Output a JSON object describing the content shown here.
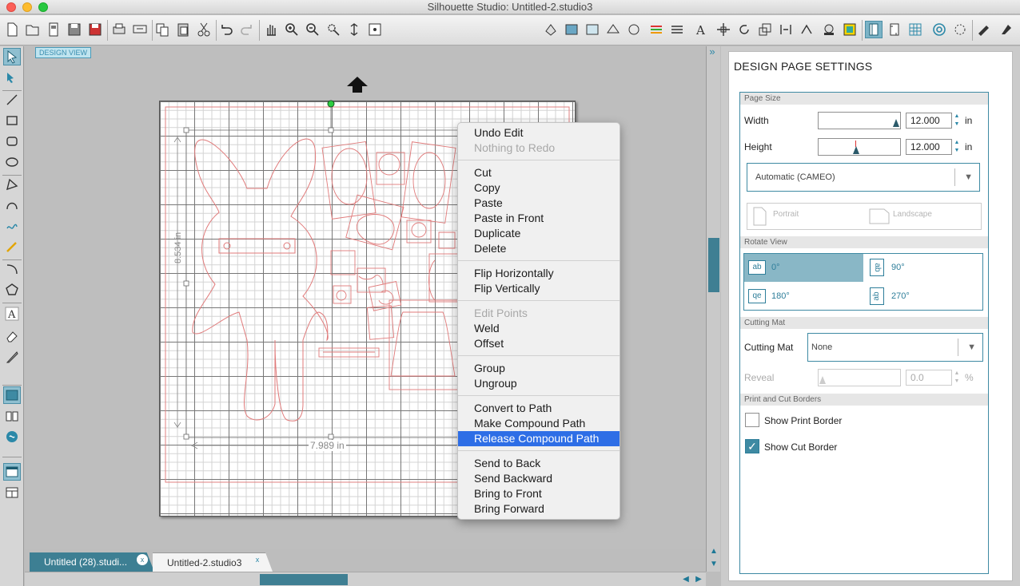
{
  "window": {
    "title": "Silhouette Studio: Untitled-2.studio3"
  },
  "canvas": {
    "design_view_label": "DESIGN VIEW",
    "height_dimension": "8.534 in",
    "width_dimension": "7.989 in"
  },
  "context_menu": {
    "groups": [
      [
        {
          "label": "Undo Edit",
          "enabled": true
        },
        {
          "label": "Nothing to Redo",
          "enabled": false
        }
      ],
      [
        {
          "label": "Cut",
          "enabled": true
        },
        {
          "label": "Copy",
          "enabled": true
        },
        {
          "label": "Paste",
          "enabled": true
        },
        {
          "label": "Paste in Front",
          "enabled": true
        },
        {
          "label": "Duplicate",
          "enabled": true
        },
        {
          "label": "Delete",
          "enabled": true
        }
      ],
      [
        {
          "label": "Flip Horizontally",
          "enabled": true
        },
        {
          "label": "Flip Vertically",
          "enabled": true
        }
      ],
      [
        {
          "label": "Edit Points",
          "enabled": false
        },
        {
          "label": "Weld",
          "enabled": true
        },
        {
          "label": "Offset",
          "enabled": true
        }
      ],
      [
        {
          "label": "Group",
          "enabled": true
        },
        {
          "label": "Ungroup",
          "enabled": true
        }
      ],
      [
        {
          "label": "Convert to Path",
          "enabled": true
        },
        {
          "label": "Make Compound Path",
          "enabled": true
        },
        {
          "label": "Release Compound Path",
          "enabled": true,
          "highlighted": true
        }
      ],
      [
        {
          "label": "Send to Back",
          "enabled": true
        },
        {
          "label": "Send Backward",
          "enabled": true
        },
        {
          "label": "Bring to Front",
          "enabled": true
        },
        {
          "label": "Bring Forward",
          "enabled": true
        }
      ]
    ]
  },
  "tabs": [
    {
      "label": "Untitled (28).studi...",
      "active": false,
      "close": "x"
    },
    {
      "label": "Untitled-2.studio3",
      "active": true,
      "close": "x"
    }
  ],
  "panel": {
    "title": "DESIGN PAGE SETTINGS",
    "page_size": {
      "header": "Page Size",
      "width_label": "Width",
      "width_value": "12.000",
      "width_unit": "in",
      "height_label": "Height",
      "height_value": "12.000",
      "height_unit": "in",
      "device": "Automatic (CAMEO)",
      "portrait": "Portrait",
      "landscape": "Landscape"
    },
    "rotate_view": {
      "header": "Rotate View",
      "options": [
        {
          "label": "0°",
          "icon": "ab",
          "selected": true
        },
        {
          "label": "90°",
          "icon": "ab",
          "selected": false
        },
        {
          "label": "180°",
          "icon": "qe",
          "selected": false
        },
        {
          "label": "270°",
          "icon": "ab",
          "selected": false
        }
      ]
    },
    "cutting_mat": {
      "header": "Cutting Mat",
      "label": "Cutting Mat",
      "value": "None",
      "reveal_label": "Reveal",
      "reveal_value": "0.0",
      "reveal_unit": "%"
    },
    "borders": {
      "header": "Print and Cut Borders",
      "show_print_border": "Show Print Border",
      "print_checked": false,
      "show_cut_border": "Show Cut Border",
      "cut_checked": true,
      "check_mark": "✓"
    }
  },
  "colors": {
    "accent": "#3e8aa3",
    "highlight": "#2e6ee6",
    "cut_line": "#e07a7a"
  }
}
